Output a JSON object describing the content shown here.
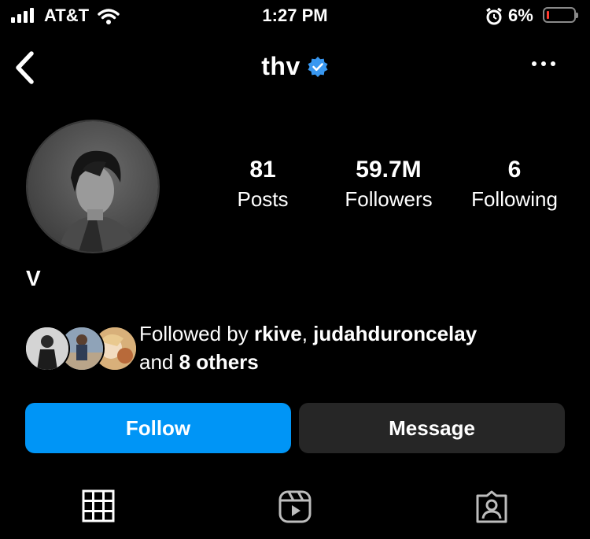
{
  "status_bar": {
    "carrier": "AT&T",
    "time": "1:27 PM",
    "battery_percent": "6%",
    "battery_level": 0.06,
    "icons": [
      "signal-icon",
      "wifi-icon",
      "alarm-icon",
      "battery-icon"
    ]
  },
  "header": {
    "handle": "thv",
    "verified_icon": "verified-badge-icon",
    "back_icon": "chevron-left-icon",
    "more_icon": "more-horizontal-icon"
  },
  "profile": {
    "display_name": "V",
    "stats": [
      {
        "value": "81",
        "label": "Posts"
      },
      {
        "value": "59.7M",
        "label": "Followers"
      },
      {
        "value": "6",
        "label": "Following"
      }
    ]
  },
  "followed_by": {
    "prefix": "Followed by ",
    "users": [
      "rkive",
      "judahduroncelay"
    ],
    "separator": ", ",
    "and_text": "and ",
    "others": "8 others"
  },
  "actions": {
    "follow_label": "Follow",
    "message_label": "Message"
  },
  "tabs": [
    "grid-icon",
    "reels-icon",
    "tagged-icon"
  ],
  "colors": {
    "accent": "#0095f6",
    "secondary_button": "#262626",
    "verified": "#3897f0",
    "battery_low": "#ff3b30"
  }
}
